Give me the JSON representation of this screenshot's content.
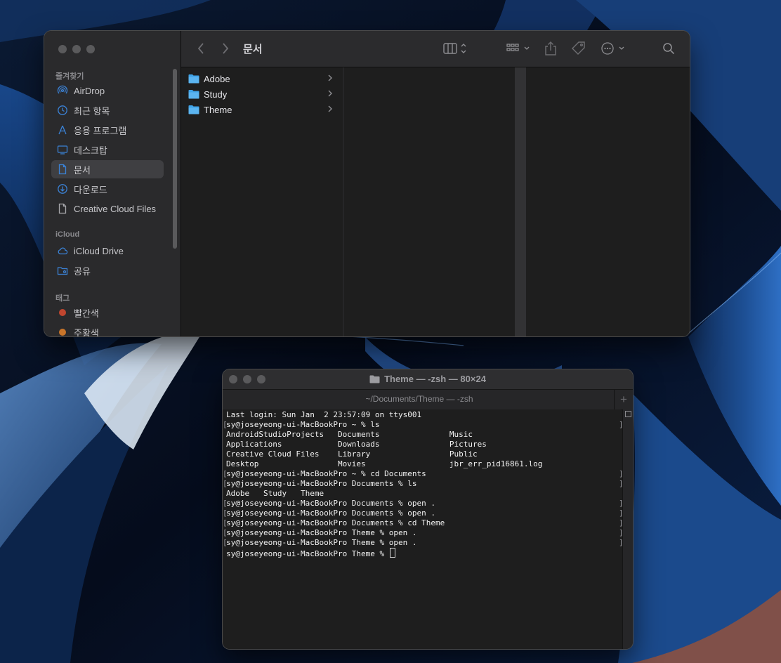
{
  "finder": {
    "title": "문서",
    "sidebar": {
      "favorites_header": "즐겨찾기",
      "favorites": [
        {
          "label": "AirDrop",
          "icon": "airdrop-icon"
        },
        {
          "label": "최근 항목",
          "icon": "clock-icon"
        },
        {
          "label": "응용 프로그램",
          "icon": "applications-icon"
        },
        {
          "label": "데스크탑",
          "icon": "desktop-icon"
        },
        {
          "label": "문서",
          "icon": "document-icon",
          "selected": true
        },
        {
          "label": "다운로드",
          "icon": "download-icon"
        },
        {
          "label": "Creative Cloud Files",
          "icon": "file-icon"
        }
      ],
      "icloud_header": "iCloud",
      "icloud": [
        {
          "label": "iCloud Drive",
          "icon": "cloud-icon"
        },
        {
          "label": "공유",
          "icon": "shared-folder-icon"
        }
      ],
      "tags_header": "태그",
      "tags": [
        {
          "label": "빨간색",
          "color": "#c0462f"
        },
        {
          "label": "주황색",
          "color": "#c9752a"
        }
      ]
    },
    "columns": [
      {
        "items": [
          {
            "name": "Adobe",
            "has_children": true
          },
          {
            "name": "Study",
            "has_children": true
          },
          {
            "name": "Theme",
            "has_children": true
          }
        ]
      }
    ]
  },
  "terminal": {
    "title": "Theme — -zsh — 80×24",
    "tab_label": "~/Documents/Theme — -zsh",
    "new_tab_glyph": "+",
    "lines": [
      "Last login: Sun Jan  2 23:57:09 on ttys001",
      "sy@joseyeong-ui-MacBookPro ~ % ls",
      "AndroidStudioProjects   Documents               Music",
      "Applications            Downloads               Pictures",
      "Creative Cloud Files    Library                 Public",
      "Desktop                 Movies                  jbr_err_pid16861.log",
      "sy@joseyeong-ui-MacBookPro ~ % cd Documents",
      "sy@joseyeong-ui-MacBookPro Documents % ls",
      "Adobe   Study   Theme",
      "sy@joseyeong-ui-MacBookPro Documents % open .",
      "sy@joseyeong-ui-MacBookPro Documents % open .",
      "sy@joseyeong-ui-MacBookPro Documents % cd Theme",
      "sy@joseyeong-ui-MacBookPro Theme % open .",
      "sy@joseyeong-ui-MacBookPro Theme % open .",
      "sy@joseyeong-ui-MacBookPro Theme % "
    ]
  },
  "colors": {
    "folder_blue": "#3fa3e8",
    "sidebar_icon_blue": "#3b82d6",
    "window_bg": "#1e1e1e",
    "sidebar_bg": "#2a2a2c"
  }
}
